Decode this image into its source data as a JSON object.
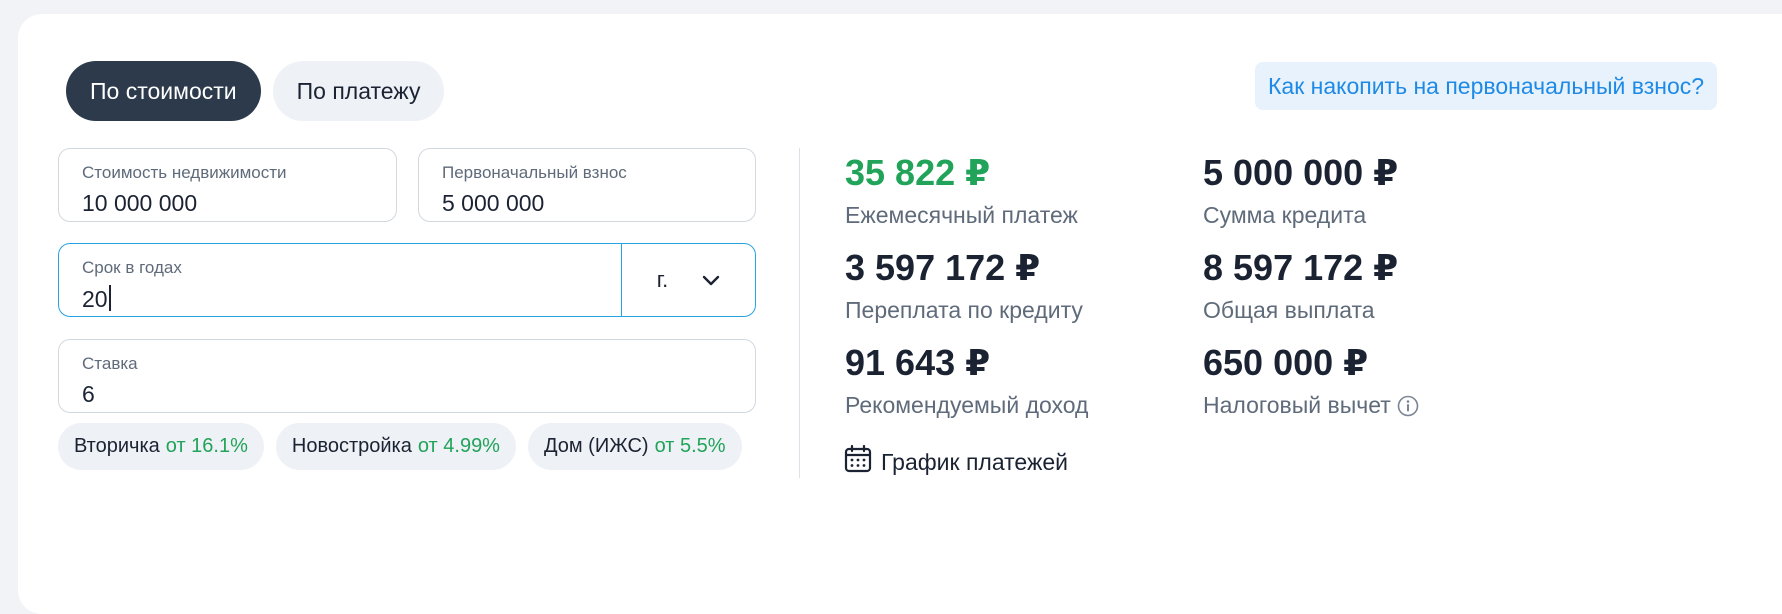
{
  "tabs": [
    {
      "label": "По стоимости",
      "active": true
    },
    {
      "label": "По платежу",
      "active": false
    }
  ],
  "help_link": "Как накопить на первоначальный взнос?",
  "form": {
    "property_cost": {
      "label": "Стоимость недвижимости",
      "value": "10 000 000"
    },
    "down_payment": {
      "label": "Первоначальный взнос",
      "value": "5 000 000"
    },
    "term": {
      "label": "Срок в годах",
      "value": "20",
      "unit": "г."
    },
    "rate": {
      "label": "Ставка",
      "value": "6"
    }
  },
  "chips": [
    {
      "name": "Вторичка",
      "rate": "от 16.1%"
    },
    {
      "name": "Новостройка",
      "rate": "от 4.99%"
    },
    {
      "name": "Дом (ИЖС)",
      "rate": "от 5.5%"
    }
  ],
  "results": {
    "monthly": {
      "value": "35 822 ₽",
      "label": "Ежемесячный платеж"
    },
    "loan": {
      "value": "5 000 000 ₽",
      "label": "Сумма кредита"
    },
    "overpay": {
      "value": "3 597 172 ₽",
      "label": "Переплата по кредиту"
    },
    "total": {
      "value": "8 597 172 ₽",
      "label": "Общая выплата"
    },
    "income": {
      "value": "91 643 ₽",
      "label": "Рекомендуемый доход"
    },
    "tax": {
      "value": "650 000 ₽",
      "label": "Налоговый вычет"
    }
  },
  "schedule_label": "График платежей",
  "colors": {
    "accent_green": "#22a35a",
    "link_blue": "#1e8ae6",
    "focus_border": "#27a3e0",
    "dark_tab": "#2c3a4b"
  },
  "icons": {
    "schedule": "calendar-icon",
    "tax_info": "info-icon",
    "unit_dropdown": "chevron-down-icon"
  }
}
